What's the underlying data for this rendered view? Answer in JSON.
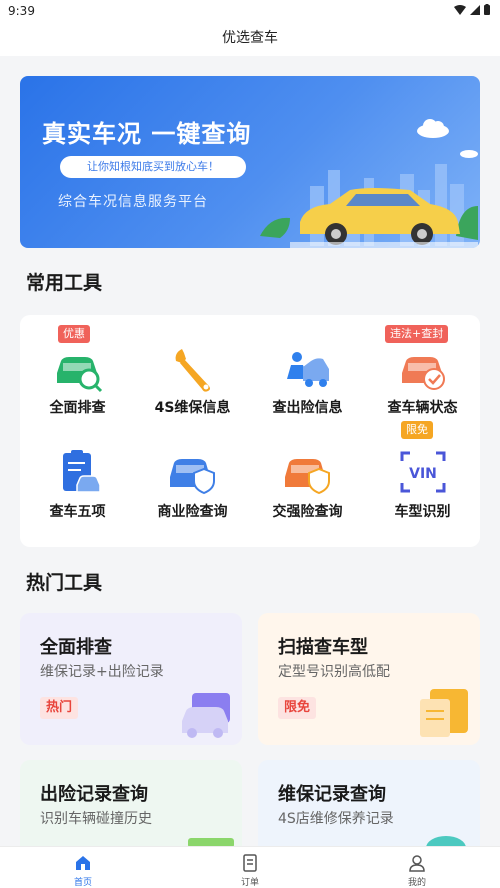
{
  "status": {
    "time": "9:39"
  },
  "header": {
    "title": "优选查车"
  },
  "banner": {
    "title": "真实车况 一键查询",
    "pill": "让你知根知底买到放心车！",
    "subtitle": "综合车况信息服务平台"
  },
  "sections": {
    "common_tools": "常用工具",
    "hot_tools": "热门工具"
  },
  "tools": [
    {
      "label": "全面排查",
      "badge": "优惠",
      "icon": "car-search-icon"
    },
    {
      "label": "4S维保信息",
      "badge": "",
      "icon": "wrench-icon"
    },
    {
      "label": "查出险信息",
      "badge": "",
      "icon": "car-repair-icon"
    },
    {
      "label": "查车辆状态",
      "badge": "违法+查封",
      "icon": "car-check-icon"
    },
    {
      "label": "查车五项",
      "badge": "",
      "icon": "clipboard-car-icon"
    },
    {
      "label": "商业险查询",
      "badge": "",
      "icon": "car-shield-icon"
    },
    {
      "label": "交强险查询",
      "badge": "",
      "icon": "car-insurance-icon"
    },
    {
      "label": "车型识别",
      "badge": "限免",
      "icon": "vin-scan-icon"
    }
  ],
  "hot_tools": [
    {
      "title": "全面排查",
      "desc": "维保记录+出险记录",
      "badge": "热门"
    },
    {
      "title": "扫描查车型",
      "desc": "定型号识别高低配",
      "badge": "限免"
    },
    {
      "title": "出险记录查询",
      "desc": "识别车辆碰撞历史",
      "badge": ""
    },
    {
      "title": "维保记录查询",
      "desc": "4S店维修保养记录",
      "badge": ""
    }
  ],
  "tabs": [
    {
      "label": "首页",
      "icon": "home-icon",
      "active": true
    },
    {
      "label": "订单",
      "icon": "order-icon",
      "active": false
    },
    {
      "label": "我的",
      "icon": "profile-icon",
      "active": false
    }
  ],
  "colors": {
    "primary": "#2a73e8",
    "badge_red": "#f0625a",
    "badge_orange": "#f5a623"
  }
}
